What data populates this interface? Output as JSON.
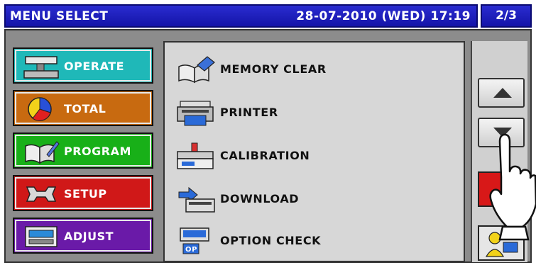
{
  "title_bar": {
    "title": "MENU SELECT",
    "datetime": "28-07-2010 (WED) 17:19",
    "page": "2/3"
  },
  "menu": [
    {
      "label": "OPERATE",
      "color": "#1fb8b8",
      "icon": "scale-icon"
    },
    {
      "label": "TOTAL",
      "color": "#c86a10",
      "icon": "pie-chart-icon"
    },
    {
      "label": "PROGRAM",
      "color": "#18b018",
      "icon": "book-pen-icon"
    },
    {
      "label": "SETUP",
      "color": "#d01818",
      "icon": "wrench-icon"
    },
    {
      "label": "ADJUST",
      "color": "#6a1aa8",
      "icon": "adjust-display-icon"
    }
  ],
  "submenu": [
    {
      "label": "MEMORY CLEAR",
      "icon": "eraser-book-icon"
    },
    {
      "label": "PRINTER",
      "icon": "printer-icon"
    },
    {
      "label": "CALIBRATION",
      "icon": "calibration-scale-icon"
    },
    {
      "label": "DOWNLOAD",
      "icon": "download-icon"
    },
    {
      "label": "OPTION CHECK",
      "icon": "option-check-icon"
    }
  ],
  "right_buttons": {
    "up": "up-arrow-icon",
    "down": "down-arrow-icon",
    "operator": "operator-icon"
  },
  "colors": {
    "title_bar": "#1a1cc0",
    "panel": "#d7d7d7",
    "frame": "#8c8c8c"
  }
}
